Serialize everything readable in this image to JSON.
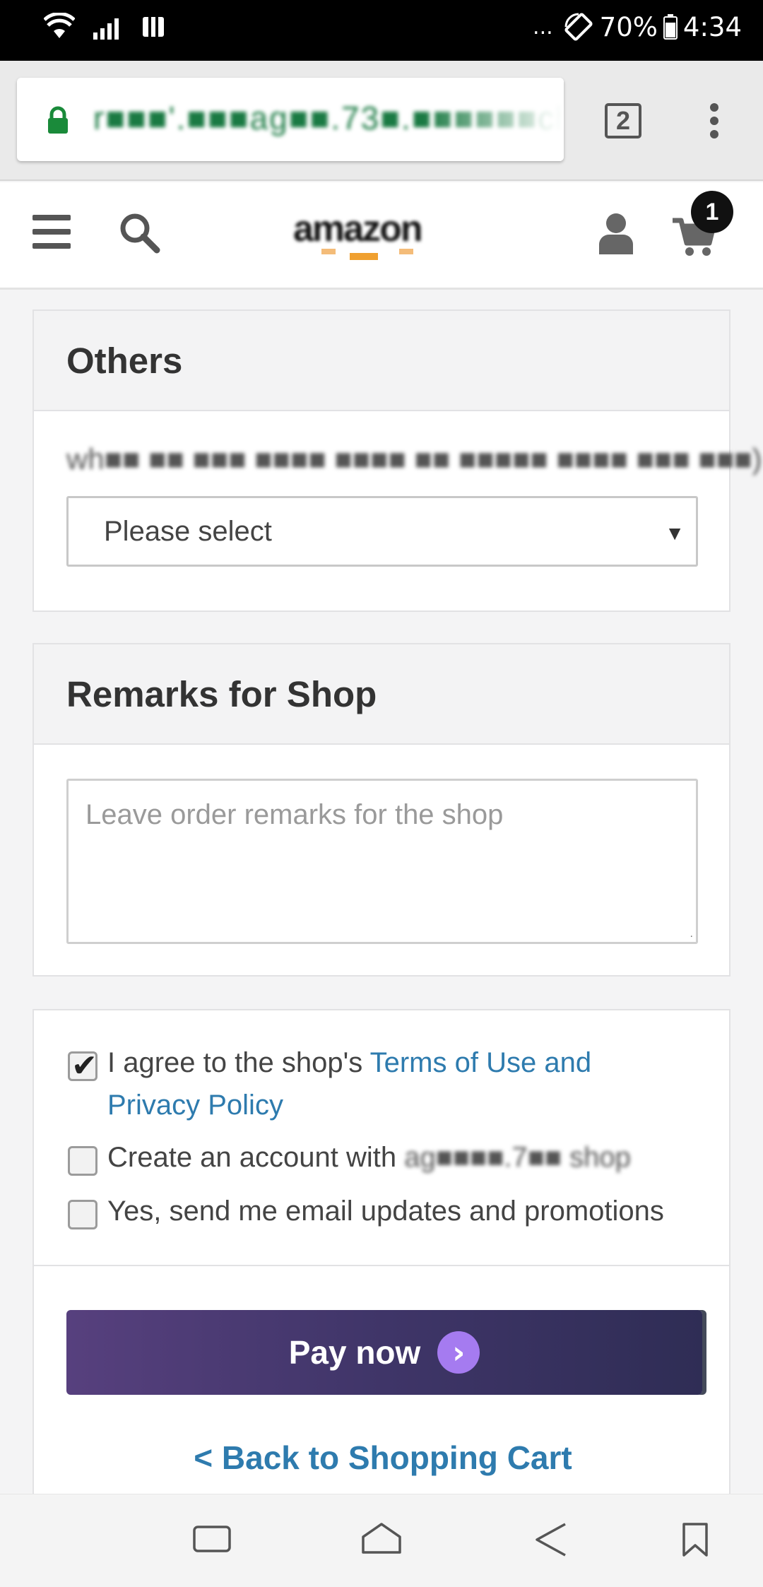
{
  "status_bar": {
    "dots": "...",
    "battery": "70%",
    "time": "4:34"
  },
  "browser": {
    "url": "r■■■'.■■■ag■■.73■.■■■■■■ch",
    "tab_count": "2"
  },
  "header": {
    "cart_count": "1",
    "logo_text": "amazon"
  },
  "others": {
    "title": "Others",
    "question": "wh■■ ■■ ■■■ ■■■■ ■■■■ ■■ ■■■■■ ■■■■ ■■■ ■■■)",
    "select_value": "Please select"
  },
  "remarks": {
    "title": "Remarks for Shop",
    "placeholder": "Leave order remarks for the shop"
  },
  "agreement": {
    "agree_prefix": "I agree to the shop's ",
    "agree_link_1": "Terms of Use and",
    "agree_link_2": "Privacy Policy",
    "create_prefix": "Create an account with ",
    "create_blurred": "ag■■■■.7■■ shop",
    "email_updates": "Yes, send me email updates and promotions",
    "agree_checked": true,
    "create_checked": false,
    "email_checked": false
  },
  "pay": {
    "label": "Pay now",
    "arrow": "›"
  },
  "back": {
    "label": "< Back to Shopping Cart"
  },
  "colors": {
    "link": "#2e7bae",
    "pay_start": "#57407e",
    "pay_end": "#2f2d55",
    "url_green": "#1a7a43"
  }
}
